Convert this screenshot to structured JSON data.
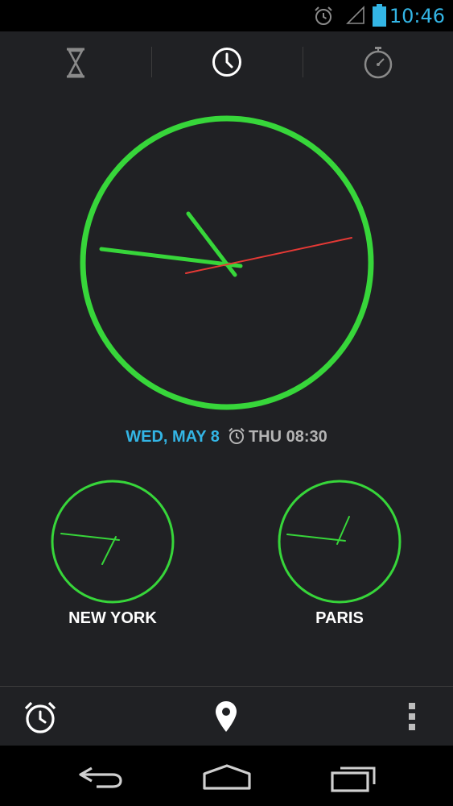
{
  "status_bar": {
    "time": "10:46",
    "icons": [
      "alarm-icon",
      "signal-icon",
      "battery-icon"
    ],
    "accent_color": "#33b5e5"
  },
  "tabs": [
    {
      "name": "timer",
      "icon": "hourglass-icon",
      "selected": false
    },
    {
      "name": "clock",
      "icon": "clock-icon",
      "selected": true
    },
    {
      "name": "stopwatch",
      "icon": "stopwatch-icon",
      "selected": false
    }
  ],
  "main_clock": {
    "ring_color": "#37d63a",
    "second_hand_color": "#e53935"
  },
  "date_row": {
    "date": "WED, MAY 8",
    "next_alarm": "THU 08:30",
    "date_color": "#33b5e5"
  },
  "world_clocks": [
    {
      "city": "NEW YORK"
    },
    {
      "city": "PARIS"
    }
  ],
  "action_bar": {
    "icons": [
      "alarm-clock-icon",
      "location-pin-icon",
      "overflow-menu-icon"
    ]
  },
  "nav_bar": {
    "icons": [
      "back-icon",
      "home-icon",
      "recents-icon"
    ]
  }
}
